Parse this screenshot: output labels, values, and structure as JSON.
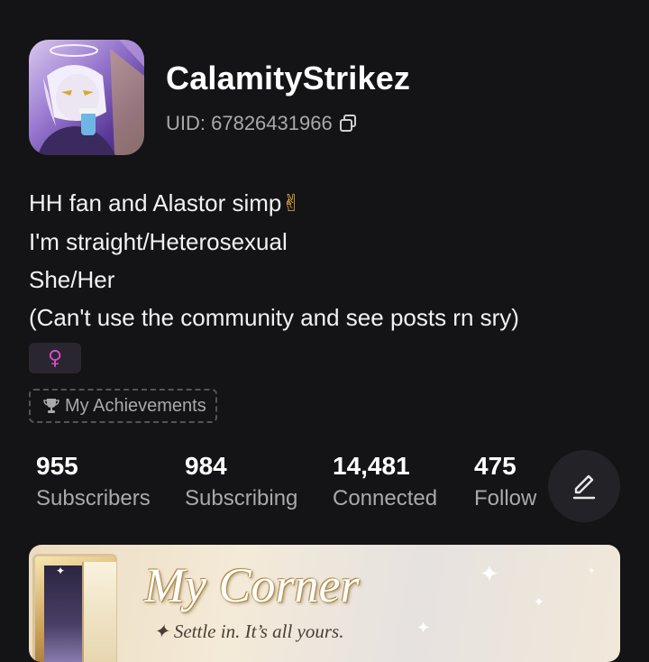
{
  "profile": {
    "username": "CalamityStrikez",
    "uid": "UID: 67826431966",
    "bio": [
      "HH fan and Alastor simp",
      "I'm straight/Heterosexual",
      "She/Her",
      "(Can't use the community and see posts rn sry)"
    ],
    "bio_emoji": "✌",
    "gender_symbol": "♀",
    "achievements_label": "My Achievements"
  },
  "stats": [
    {
      "value": "955",
      "label": "Subscribers"
    },
    {
      "value": "984",
      "label": "Subscribing"
    },
    {
      "value": "14,481",
      "label": "Connected"
    },
    {
      "value": "475",
      "label": "Follow"
    }
  ],
  "corner": {
    "title": "My Corner",
    "subtitle": "✦ Settle in. It’s all yours."
  },
  "icons": {
    "copy": "copy-icon",
    "trophy": "trophy-icon",
    "edit": "pencil-icon",
    "gender": "female-icon"
  },
  "colors": {
    "background": "#141315",
    "secondary_text": "#a9a8ad",
    "gender_accent": "#d04fc8",
    "edit_button_bg": "#232226"
  }
}
